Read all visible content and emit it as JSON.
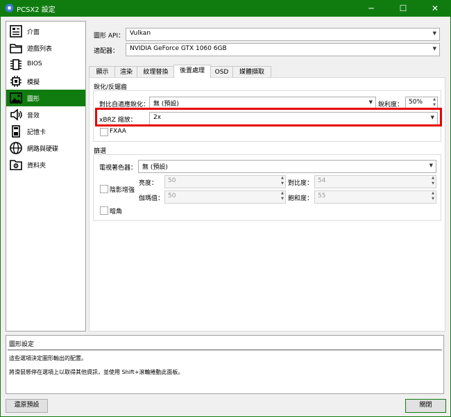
{
  "window": {
    "title": "PCSX2 設定",
    "minimize": "─",
    "maximize": "☐",
    "close": "✕"
  },
  "sidebar": {
    "items": [
      {
        "label": "介面",
        "icon": "interface-icon"
      },
      {
        "label": "遊戲列表",
        "icon": "folder-icon"
      },
      {
        "label": "BIOS",
        "icon": "chip-icon"
      },
      {
        "label": "模擬",
        "icon": "emulation-icon"
      },
      {
        "label": "圖形",
        "icon": "image-icon"
      },
      {
        "label": "音效",
        "icon": "speaker-icon"
      },
      {
        "label": "記憶卡",
        "icon": "memory-card-icon"
      },
      {
        "label": "網路與硬碟",
        "icon": "globe-icon"
      },
      {
        "label": "資料夾",
        "icon": "settings-folder-icon"
      }
    ]
  },
  "graphics": {
    "api_label": "圖形 API：",
    "api_value": "Vulkan",
    "adapter_label": "適配器：",
    "adapter_value": "NVIDIA GeForce GTX 1060 6GB"
  },
  "tabs": [
    "顯示",
    "渲染",
    "紋理替換",
    "後置處理",
    "OSD",
    "媒體擷取"
  ],
  "post": {
    "sharpen_group": "銳化/反鋸齒",
    "cas_label": "對比自適應銳化：",
    "cas_value": "無 (預設)",
    "sharpness_label": "銳利度：",
    "sharpness_value": "50%",
    "xbrz_label": "xBRZ 縮放：",
    "xbrz_value": "2x",
    "fxaa_label": "FXAA",
    "filters_group": "篩選",
    "shade_boost_label": "電視著色器：",
    "shade_boost_value": "無 (預設)",
    "shadeboost_check": "陰影增強",
    "brightness_label": "亮度：",
    "brightness_value": "50",
    "contrast_label": "對比度：",
    "contrast_value": "54",
    "gamma_label": "伽瑪值：",
    "gamma_value": "50",
    "saturation_label": "飽和度：",
    "saturation_value": "55",
    "darken_label": "暗角"
  },
  "description": {
    "title": "圖形設定",
    "line1": "這些選項決定圖形輸出的配置。",
    "line2": "將滑鼠懸停在選項上以取得其他資訊，並使用 Shift+滾輪捲動此面板。"
  },
  "buttons": {
    "restore": "還原預設",
    "close": "關閉"
  }
}
